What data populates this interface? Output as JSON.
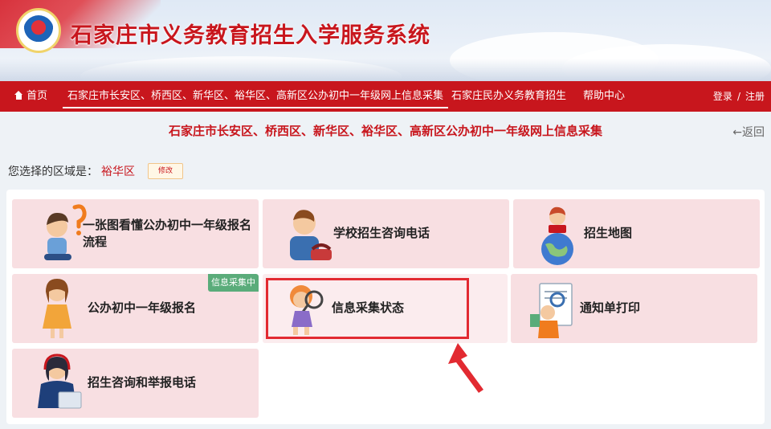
{
  "header": {
    "site_title": "石家庄市义务教育招生入学服务系统"
  },
  "nav": {
    "items": [
      {
        "label": "首页",
        "icon": "home-icon"
      },
      {
        "label": "石家庄市长安区、桥西区、新华区、裕华区、高新区公办初中一年级网上信息采集"
      },
      {
        "label": "石家庄民办义务教育招生"
      },
      {
        "label": "帮助中心"
      }
    ],
    "login": "登录",
    "separator": "/",
    "register": "注册"
  },
  "page": {
    "heading": "石家庄市长安区、桥西区、新华区、裕华区、高新区公办初中一年级网上信息采集",
    "back": "←返回",
    "region_label": "您选择的区域是：",
    "region_value": "裕华区",
    "edit_button": "修改"
  },
  "cards": [
    {
      "label": "一张图看懂公办初中一年级报名流程",
      "icon": "thinking-student-icon"
    },
    {
      "label": "学校招生咨询电话",
      "icon": "phone-call-icon"
    },
    {
      "label": "招生地图",
      "icon": "globe-reader-icon"
    },
    {
      "label": "公办初中一年级报名",
      "icon": "girl-student-icon",
      "badge": "信息采集中"
    },
    {
      "label": "信息采集状态",
      "icon": "magnifier-girl-icon"
    },
    {
      "label": "通知单打印",
      "icon": "print-notice-icon"
    },
    {
      "label": "招生咨询和举报电话",
      "icon": "headset-agent-icon"
    }
  ],
  "colors": {
    "brand_red": "#c8161d",
    "card_pink": "#f8dfe2",
    "badge_green": "#5aac7a",
    "highlight_red": "#e22a31"
  }
}
